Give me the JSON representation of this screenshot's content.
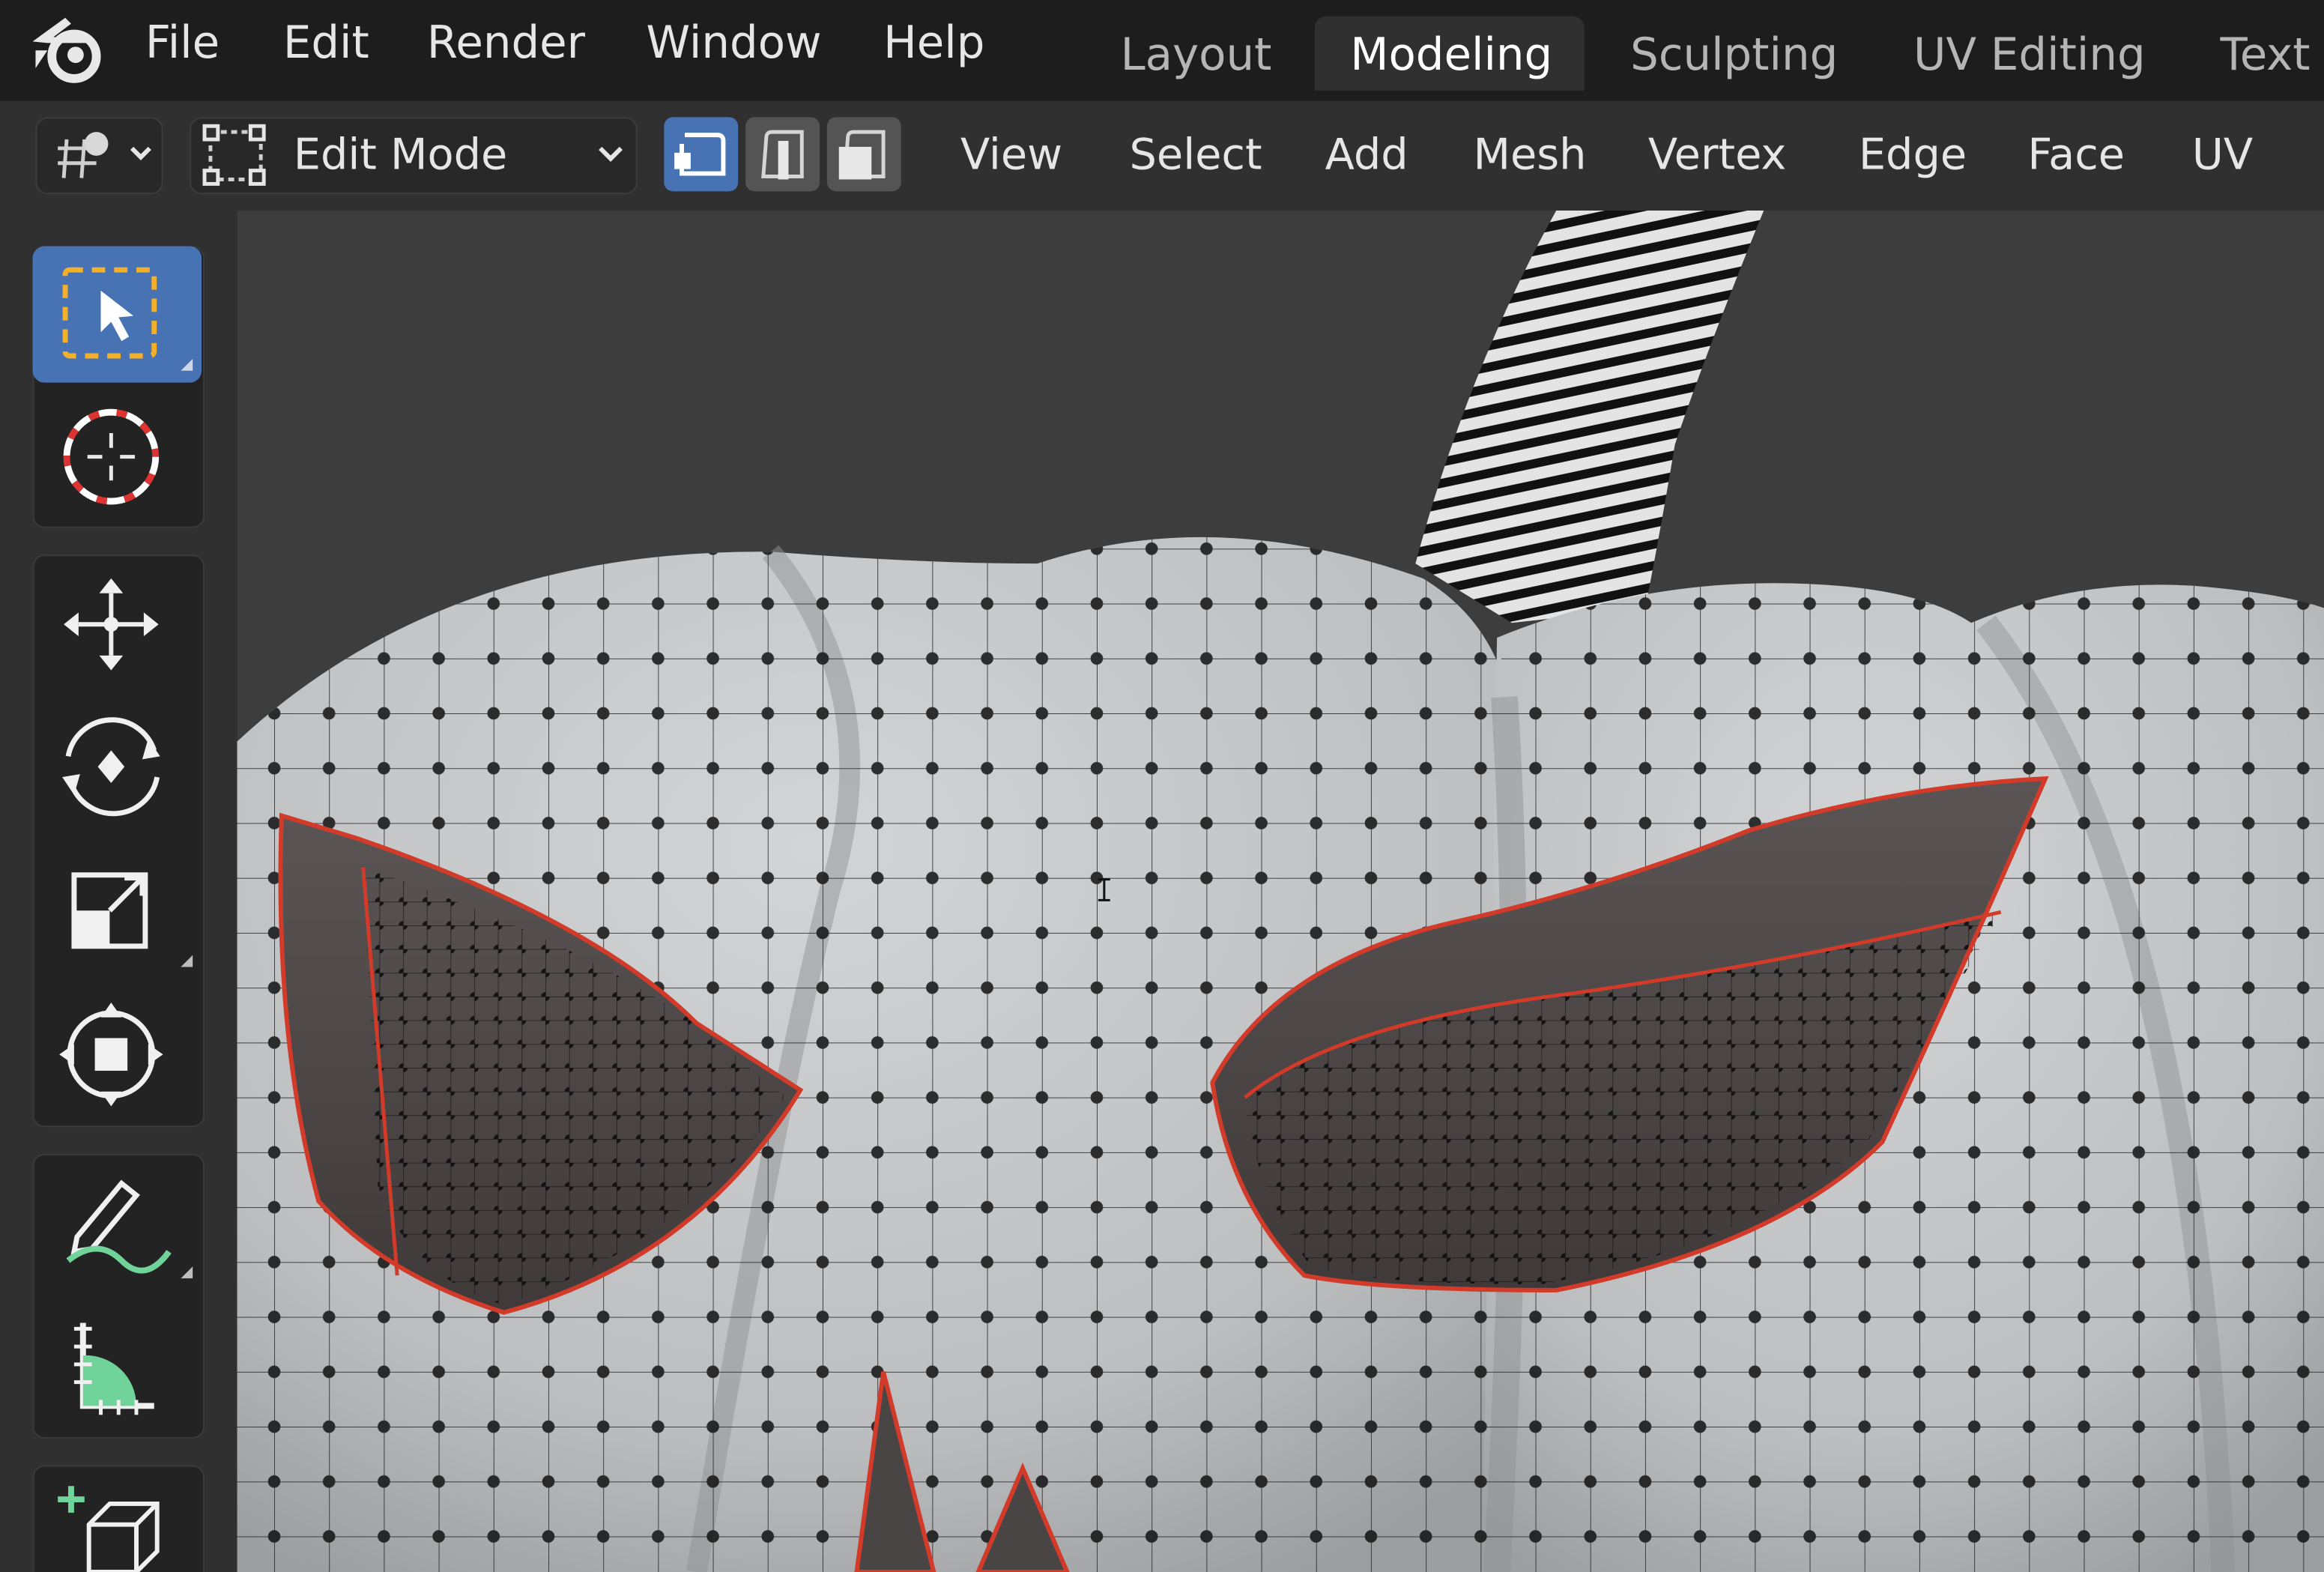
{
  "menubar": {
    "items": [
      "File",
      "Edit",
      "Render",
      "Window",
      "Help"
    ]
  },
  "workspaces": {
    "tabs": [
      "Layout",
      "Modeling",
      "Sculpting",
      "UV Editing",
      "Text"
    ],
    "active": "Modeling"
  },
  "header": {
    "mode": "Edit Mode",
    "select_modes": [
      "vertex",
      "edge",
      "face"
    ],
    "active_select_mode": "vertex",
    "menus": [
      "View",
      "Select",
      "Add",
      "Mesh",
      "Vertex",
      "Edge",
      "Face",
      "UV"
    ]
  },
  "toolbar": {
    "tools": [
      "select-box",
      "cursor",
      "move",
      "rotate",
      "scale",
      "transform",
      "annotate",
      "measure",
      "add-cube"
    ],
    "active_tool": "select-box"
  },
  "colors": {
    "accent": "#4772b3",
    "topbar": "#1d1d1d",
    "header": "#303030",
    "viewport_bg": "#3d3d3d",
    "mesh_surface": "#c3c5c7",
    "seam": "#d23a2a"
  },
  "icons": [
    "blender-logo-icon",
    "object-interaction-icon",
    "edit-mode-icon",
    "chevron-down-icon",
    "vertex-select-icon",
    "edge-select-icon",
    "face-select-icon"
  ]
}
